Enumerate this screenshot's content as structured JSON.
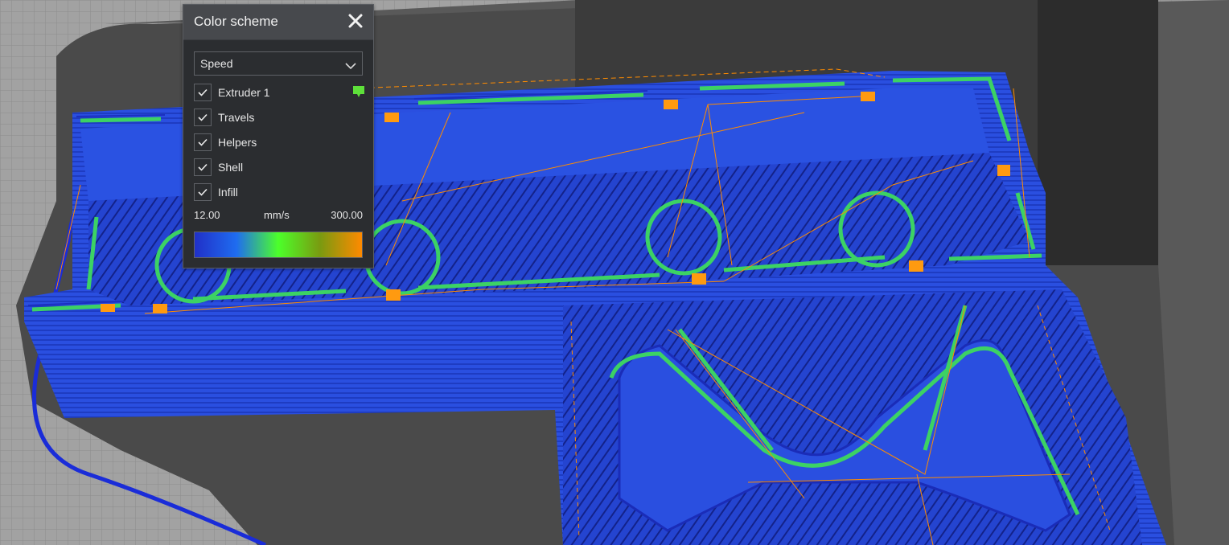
{
  "panel": {
    "title": "Color scheme",
    "close_icon": "close-icon",
    "scheme_select": {
      "value": "Speed",
      "icon": "chevron-down-icon"
    },
    "options": [
      {
        "label": "Extruder 1",
        "checked": true,
        "swatch_color": "#5ee03a"
      },
      {
        "label": "Travels",
        "checked": true
      },
      {
        "label": "Helpers",
        "checked": true
      },
      {
        "label": "Shell",
        "checked": true
      },
      {
        "label": "Infill",
        "checked": true
      }
    ],
    "legend": {
      "min": "12.00",
      "unit": "mm/s",
      "max": "300.00",
      "gradient_colors": [
        "#2030c8",
        "#1f6cf0",
        "#4cff2a",
        "#7a9a10",
        "#ff8a00"
      ]
    }
  },
  "colors": {
    "print_blue": "#2848d8",
    "shell_green": "#3cd264",
    "travel_orange": "#ff8c00",
    "build_plate": "#9c9c9c"
  }
}
